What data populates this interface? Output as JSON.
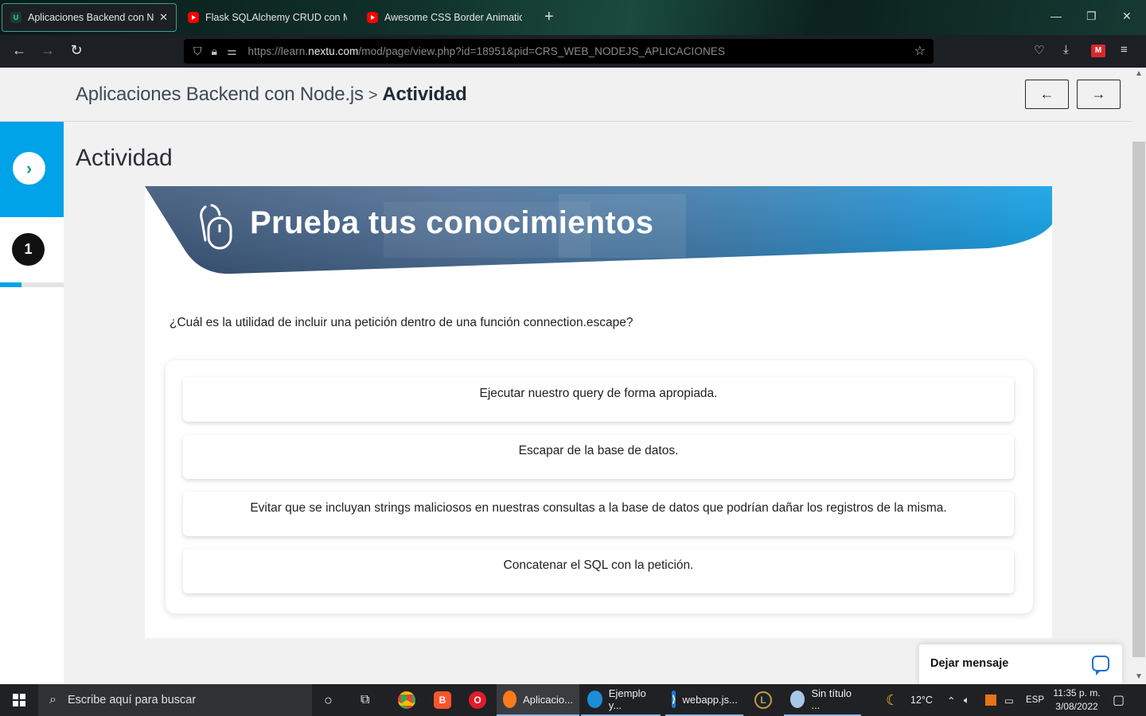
{
  "browser": {
    "tabs": [
      {
        "label": "Aplicaciones Backend con Node.js",
        "active": true,
        "favicon": "nextu-icon"
      },
      {
        "label": "Flask SQLAlchemy CRUD con MySQL",
        "active": false,
        "favicon": "youtube-icon"
      },
      {
        "label": "Awesome CSS Border Animation",
        "active": false,
        "favicon": "youtube-icon"
      }
    ],
    "url_prefix": "https://learn.",
    "url_host": "nextu.com",
    "url_path": "/mod/page/view.php?id=18951&pid=CRS_WEB_NODEJS_APLICACIONES"
  },
  "header": {
    "course": "Aplicaciones Backend con Node.js",
    "separator": ">",
    "current": "Actividad",
    "prev_label": "←",
    "next_label": "→"
  },
  "sidebar": {
    "toggle_glyph": "›",
    "step_number": "1",
    "progress": 0.34
  },
  "main": {
    "title": "Actividad",
    "banner_title": "Prueba tus conocimientos",
    "question": "¿Cuál es la utilidad de incluir una petición dentro de una función connection.escape?",
    "options": [
      "Ejecutar nuestro query de forma apropiada.",
      "Escapar de la base de datos.",
      "Evitar que se incluyan strings maliciosos en nuestras consultas a la base de datos que podrían dañar los registros de la misma.",
      "Concatenar el SQL con la petición."
    ]
  },
  "chat": {
    "label": "Dejar mensaje"
  },
  "taskbar": {
    "search_placeholder": "Escribe aquí para buscar",
    "apps": [
      {
        "label": "Aplicacio...",
        "icon": "firefox-icon"
      },
      {
        "label": "Ejemplo y...",
        "icon": "edge-icon"
      },
      {
        "label": "webapp.js...",
        "icon": "vscode-icon"
      },
      {
        "label": "Sin título ...",
        "icon": "paint-icon"
      }
    ],
    "weather": "12°C",
    "language": "ESP",
    "time": "11:35 p. m.",
    "date": "3/08/2022"
  },
  "colors": {
    "accent_blue": "#00a2e8",
    "banner_dark": "#3a5f8c",
    "chat_blue": "#1a6fd1"
  }
}
